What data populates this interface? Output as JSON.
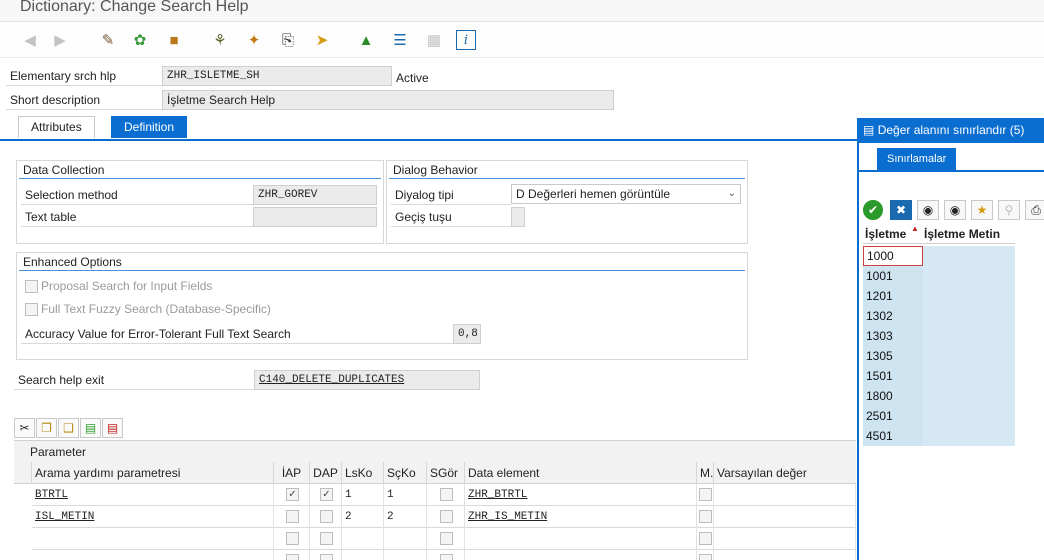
{
  "window": {
    "title": "Dictionary: Change Search Help"
  },
  "toolbar": {
    "icons": [
      "back-arrow-icon",
      "forward-arrow-icon",
      "display-change-icon",
      "check-icon",
      "activate-icon",
      "where-used-icon",
      "test-icon",
      "object-list-icon",
      "navigate-icon",
      "hierarchy-icon",
      "stack-icon",
      "table-icon",
      "info-icon"
    ]
  },
  "header": {
    "elementary_label": "Elementary srch hlp",
    "elementary_value": "ZHR_ISLETME_SH",
    "status": "Active",
    "short_desc_label": "Short description",
    "short_desc_value": "İşletme Search Help"
  },
  "tabs": {
    "attributes": "Attributes",
    "definition": "Definition"
  },
  "data_collection": {
    "title": "Data Collection",
    "selection_method_label": "Selection method",
    "selection_method_value": "ZHR_GOREV",
    "text_table_label": "Text table",
    "text_table_value": ""
  },
  "dialog_behavior": {
    "title": "Dialog Behavior",
    "dialog_type_label": "Diyalog tipi",
    "dialog_type_value": "D Değerleri hemen görüntüle",
    "hotkey_label": "Geçiş tuşu",
    "hotkey_value": ""
  },
  "enhanced_options": {
    "title": "Enhanced Options",
    "proposal_label": "Proposal Search for Input Fields",
    "fuzzy_label": "Full Text Fuzzy Search (Database-Specific)",
    "accuracy_label": "Accuracy Value for Error-Tolerant Full Text Search",
    "accuracy_value": "0,8"
  },
  "exit": {
    "label": "Search help exit",
    "value": "C140_DELETE_DUPLICATES"
  },
  "parameter": {
    "section_label": "Parameter",
    "columns": [
      "Arama yardımı parametresi",
      "İAP",
      "DAP",
      "LsKo",
      "SçKo",
      "SGör",
      "Data element",
      "M...",
      "Varsayılan değer"
    ],
    "rows": [
      {
        "param": "BTRTL",
        "iap": true,
        "dap": true,
        "lsko": "1",
        "scko": "1",
        "sgor": false,
        "data_element": "ZHR_BTRTL",
        "m": false,
        "default": ""
      },
      {
        "param": "ISL_METIN",
        "iap": false,
        "dap": false,
        "lsko": "2",
        "scko": "2",
        "sgor": false,
        "data_element": "ZHR_IS_METIN",
        "m": false,
        "default": ""
      },
      {
        "param": "",
        "iap": false,
        "dap": false,
        "lsko": "",
        "scko": "",
        "sgor": false,
        "data_element": "",
        "m": false,
        "default": ""
      },
      {
        "param": "",
        "iap": false,
        "dap": false,
        "lsko": "",
        "scko": "",
        "sgor": false,
        "data_element": "",
        "m": false,
        "default": ""
      }
    ]
  },
  "popup": {
    "title": "Değer alanını sınırlandır (5)",
    "tab": "Sınırlamalar",
    "columns": [
      "İşletme",
      "İşletme Metin"
    ],
    "values": [
      "1000",
      "1001",
      "1201",
      "1302",
      "1303",
      "1305",
      "1501",
      "1800",
      "2501",
      "4501"
    ]
  },
  "colors": {
    "accent": "#0a6ed1",
    "row_highlight": "#cfe4f1"
  }
}
